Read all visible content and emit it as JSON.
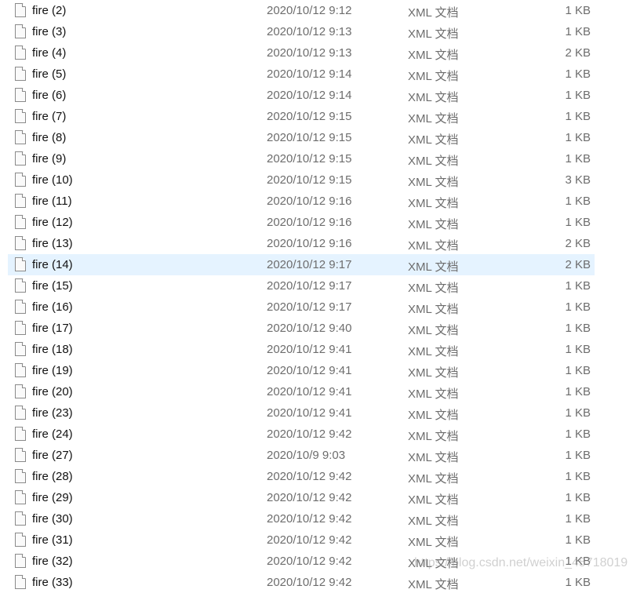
{
  "files": [
    {
      "name": "fire (2)",
      "date": "2020/10/12 9:12",
      "type": "XML 文档",
      "size": "1 KB"
    },
    {
      "name": "fire (3)",
      "date": "2020/10/12 9:13",
      "type": "XML 文档",
      "size": "1 KB"
    },
    {
      "name": "fire (4)",
      "date": "2020/10/12 9:13",
      "type": "XML 文档",
      "size": "2 KB"
    },
    {
      "name": "fire (5)",
      "date": "2020/10/12 9:14",
      "type": "XML 文档",
      "size": "1 KB"
    },
    {
      "name": "fire (6)",
      "date": "2020/10/12 9:14",
      "type": "XML 文档",
      "size": "1 KB"
    },
    {
      "name": "fire (7)",
      "date": "2020/10/12 9:15",
      "type": "XML 文档",
      "size": "1 KB"
    },
    {
      "name": "fire (8)",
      "date": "2020/10/12 9:15",
      "type": "XML 文档",
      "size": "1 KB"
    },
    {
      "name": "fire (9)",
      "date": "2020/10/12 9:15",
      "type": "XML 文档",
      "size": "1 KB"
    },
    {
      "name": "fire (10)",
      "date": "2020/10/12 9:15",
      "type": "XML 文档",
      "size": "3 KB"
    },
    {
      "name": "fire (11)",
      "date": "2020/10/12 9:16",
      "type": "XML 文档",
      "size": "1 KB"
    },
    {
      "name": "fire (12)",
      "date": "2020/10/12 9:16",
      "type": "XML 文档",
      "size": "1 KB"
    },
    {
      "name": "fire (13)",
      "date": "2020/10/12 9:16",
      "type": "XML 文档",
      "size": "2 KB"
    },
    {
      "name": "fire (14)",
      "date": "2020/10/12 9:17",
      "type": "XML 文档",
      "size": "2 KB",
      "selected": true
    },
    {
      "name": "fire (15)",
      "date": "2020/10/12 9:17",
      "type": "XML 文档",
      "size": "1 KB"
    },
    {
      "name": "fire (16)",
      "date": "2020/10/12 9:17",
      "type": "XML 文档",
      "size": "1 KB"
    },
    {
      "name": "fire (17)",
      "date": "2020/10/12 9:40",
      "type": "XML 文档",
      "size": "1 KB"
    },
    {
      "name": "fire (18)",
      "date": "2020/10/12 9:41",
      "type": "XML 文档",
      "size": "1 KB"
    },
    {
      "name": "fire (19)",
      "date": "2020/10/12 9:41",
      "type": "XML 文档",
      "size": "1 KB"
    },
    {
      "name": "fire (20)",
      "date": "2020/10/12 9:41",
      "type": "XML 文档",
      "size": "1 KB"
    },
    {
      "name": "fire (23)",
      "date": "2020/10/12 9:41",
      "type": "XML 文档",
      "size": "1 KB"
    },
    {
      "name": "fire (24)",
      "date": "2020/10/12 9:42",
      "type": "XML 文档",
      "size": "1 KB"
    },
    {
      "name": "fire (27)",
      "date": "2020/10/9 9:03",
      "type": "XML 文档",
      "size": "1 KB"
    },
    {
      "name": "fire (28)",
      "date": "2020/10/12 9:42",
      "type": "XML 文档",
      "size": "1 KB"
    },
    {
      "name": "fire (29)",
      "date": "2020/10/12 9:42",
      "type": "XML 文档",
      "size": "1 KB"
    },
    {
      "name": "fire (30)",
      "date": "2020/10/12 9:42",
      "type": "XML 文档",
      "size": "1 KB"
    },
    {
      "name": "fire (31)",
      "date": "2020/10/12 9:42",
      "type": "XML 文档",
      "size": "1 KB"
    },
    {
      "name": "fire (32)",
      "date": "2020/10/12 9:42",
      "type": "XML 文档",
      "size": "1 KB"
    },
    {
      "name": "fire (33)",
      "date": "2020/10/12 9:42",
      "type": "XML 文档",
      "size": "1 KB"
    }
  ],
  "watermark": "https://blog.csdn.net/weixin_45718019",
  "colors": {
    "selected_row": "#e5f3ff"
  }
}
